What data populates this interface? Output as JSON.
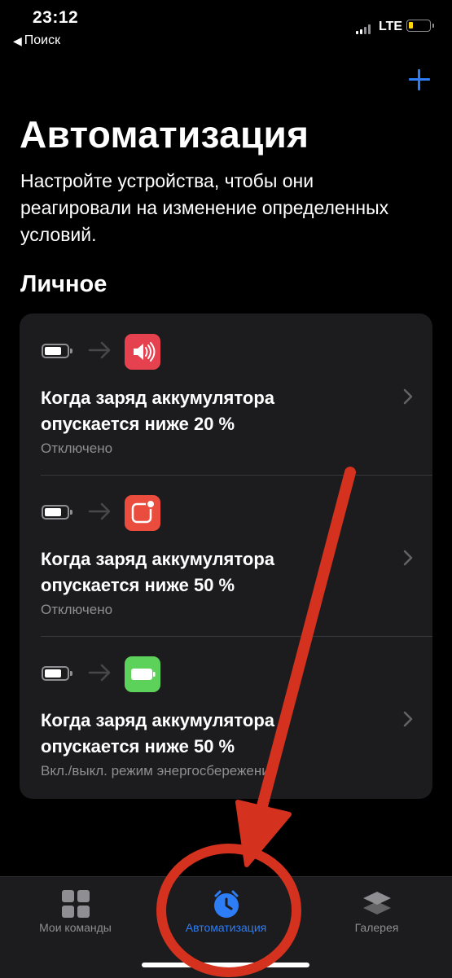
{
  "status_bar": {
    "time": "23:12",
    "back_label": "Поиск",
    "network": "LTE"
  },
  "header": {
    "title": "Автоматизация",
    "subtitle": "Настройте устройства, чтобы они реагировали на изменение определенных условий."
  },
  "section": {
    "title": "Личное"
  },
  "automations": [
    {
      "title_line1": "Когда заряд аккумулятора",
      "title_line2": "опускается ниже 20 %",
      "status": "Отключено",
      "trigger_icon": "battery-icon",
      "action_icon": "speaker-icon",
      "action_color": "#e5414f"
    },
    {
      "title_line1": "Когда заряд аккумулятора",
      "title_line2": "опускается ниже 50 %",
      "status": "Отключено",
      "trigger_icon": "battery-icon",
      "action_icon": "notification-icon",
      "action_color": "#ea4c3e"
    },
    {
      "title_line1": "Когда заряд аккумулятора",
      "title_line2": "опускается ниже 50 %",
      "status": "Вкл./выкл. режим энергосбережения",
      "trigger_icon": "battery-icon",
      "action_icon": "battery-icon",
      "action_color": "#5dd25b"
    }
  ],
  "tab_bar": {
    "tabs": [
      {
        "label": "Мои команды",
        "icon": "grid-icon",
        "active": false
      },
      {
        "label": "Автоматизация",
        "icon": "clock-icon",
        "active": true
      },
      {
        "label": "Галерея",
        "icon": "layers-icon",
        "active": false
      }
    ]
  },
  "colors": {
    "accent": "#2d7df6",
    "background": "#000000",
    "card": "#1c1c1e",
    "annotation": "#d4321f"
  }
}
